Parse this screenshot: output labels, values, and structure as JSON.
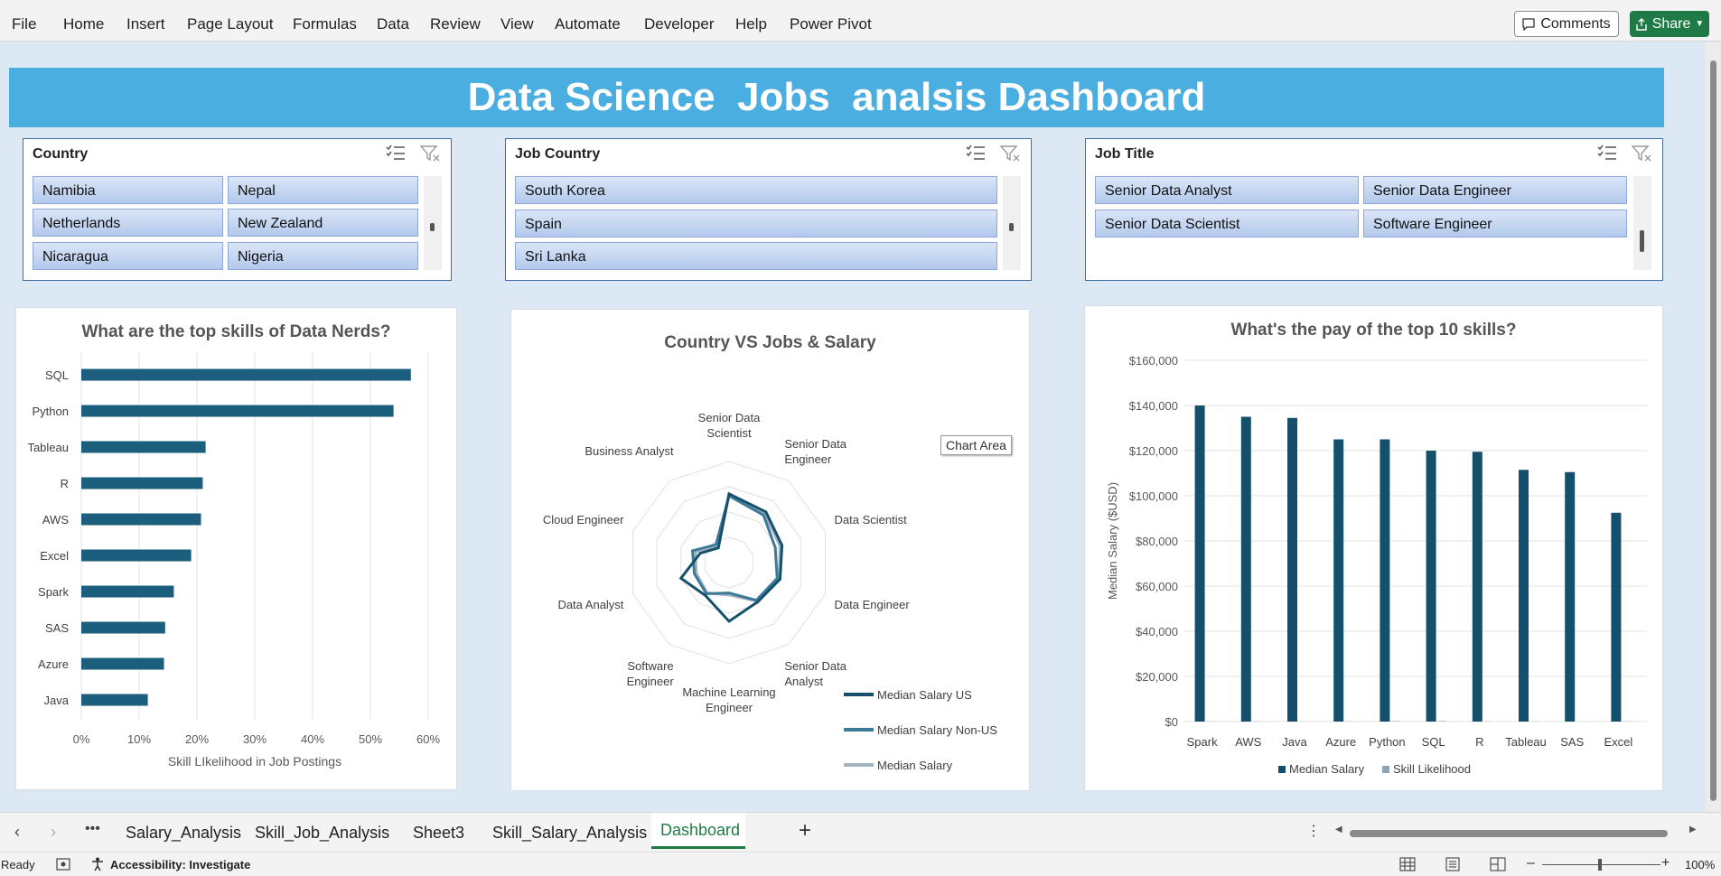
{
  "menu": [
    "File",
    "Home",
    "Insert",
    "Page Layout",
    "Formulas",
    "Data",
    "Review",
    "View",
    "Automate",
    "Developer",
    "Help",
    "Power Pivot"
  ],
  "comments_label": "Comments",
  "share_label": "Share",
  "banner_title": "Data Science  Jobs  analsis Dashboard",
  "slicers": {
    "country": {
      "title": "Country",
      "items": [
        "Namibia",
        "Nepal",
        "Netherlands",
        "New Zealand",
        "Nicaragua",
        "Nigeria"
      ]
    },
    "job_country": {
      "title": "Job Country",
      "items": [
        "South Korea",
        "Spain",
        "Sri Lanka"
      ]
    },
    "job_title": {
      "title": "Job Title",
      "items": [
        "Senior Data Analyst",
        "Senior Data Engineer",
        "Senior Data Scientist",
        "Software Engineer"
      ]
    }
  },
  "tooltip": "Chart Area",
  "chart_data": [
    {
      "type": "bar",
      "title": "What are the top skills of Data Nerds?",
      "xlabel": "Skill LIkelihood in Job Postings",
      "categories": [
        "SQL",
        "Python",
        "Tableau",
        "R",
        "AWS",
        "Excel",
        "Spark",
        "SAS",
        "Azure",
        "Java"
      ],
      "values": [
        0.57,
        0.54,
        0.215,
        0.21,
        0.207,
        0.19,
        0.16,
        0.145,
        0.143,
        0.115
      ],
      "xlim": [
        0,
        0.6
      ],
      "ticks": [
        "0%",
        "10%",
        "20%",
        "30%",
        "40%",
        "50%",
        "60%"
      ],
      "color": "#1b5e7e"
    },
    {
      "type": "radar",
      "title": "Country VS Jobs & Salary",
      "axes": [
        "Senior Data Scientist",
        "Senior Data Engineer",
        "Data Scientist",
        "Data Engineer",
        "Senior Data Analyst",
        "Machine Learning Engineer",
        "Software Engineer",
        "Data Analyst",
        "Cloud Engineer",
        "Business Analyst"
      ],
      "series": [
        {
          "name": "Median Salary US",
          "color": "#14506b",
          "values": [
            0.68,
            0.62,
            0.55,
            0.53,
            0.48,
            0.58,
            0.4,
            0.5,
            0.3,
            0.18
          ]
        },
        {
          "name": "Median Salary Non-US",
          "color": "#3d7a98",
          "values": [
            0.66,
            0.58,
            0.48,
            0.5,
            0.46,
            0.3,
            0.38,
            0.36,
            0.38,
            0.22
          ]
        },
        {
          "name": "Median Salary",
          "color": "#a3b2bf",
          "values": [
            0.67,
            0.6,
            0.53,
            0.52,
            0.47,
            0.32,
            0.37,
            0.34,
            0.35,
            0.2
          ]
        }
      ]
    },
    {
      "type": "bar",
      "title": "What's the pay of the top 10 skills?",
      "ylabel": "Median Salary ($USD)",
      "categories": [
        "Spark",
        "AWS",
        "Java",
        "Azure",
        "Python",
        "SQL",
        "R",
        "Tableau",
        "SAS",
        "Excel"
      ],
      "series": [
        {
          "name": "Median Salary",
          "color": "#14506b",
          "values": [
            140000,
            135000,
            134500,
            125000,
            125000,
            120000,
            119500,
            111500,
            110500,
            92500
          ]
        },
        {
          "name": "Skill Likelihood",
          "color": "#8fa3b5",
          "values": [
            0.2,
            0.2,
            0.1,
            0.2,
            0.5,
            0.6,
            0.2,
            0.2,
            0.1,
            0.2
          ]
        }
      ],
      "ylim": [
        0,
        160000
      ],
      "ticks": [
        "$0",
        "$20,000",
        "$40,000",
        "$60,000",
        "$80,000",
        "$100,000",
        "$120,000",
        "$140,000",
        "$160,000"
      ]
    }
  ],
  "tabs": [
    "Salary_Analysis",
    "Skill_Job_Analysis",
    "Sheet3",
    "Skill_Salary_Analysis",
    "Dashboard"
  ],
  "active_tab": "Dashboard",
  "status": {
    "ready": "Ready",
    "accessibility": "Accessibility: Investigate",
    "zoom": "100%"
  }
}
